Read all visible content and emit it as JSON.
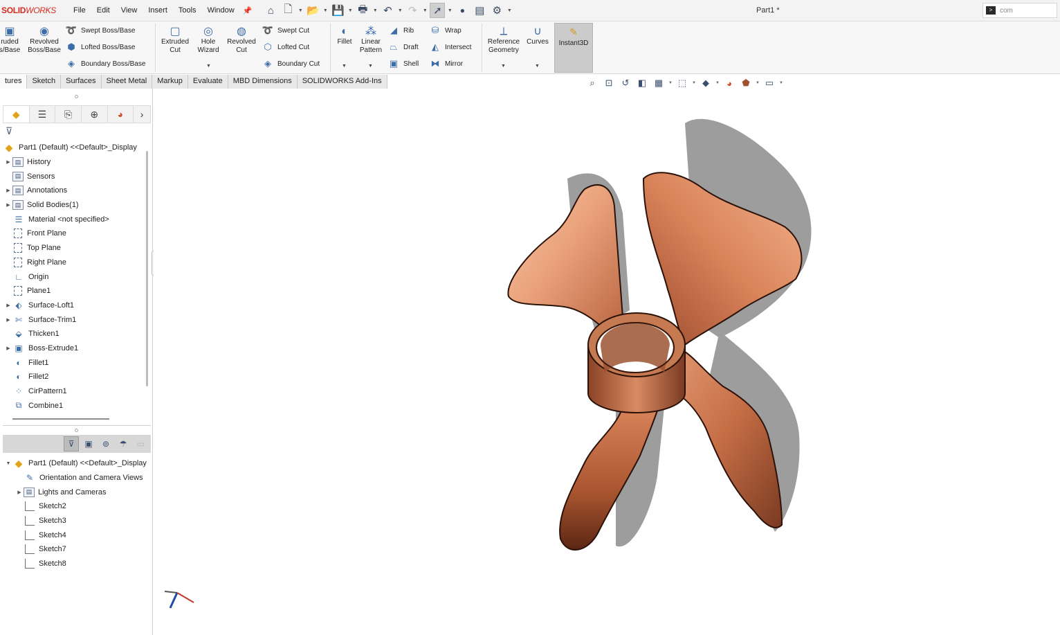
{
  "app": {
    "logo_bold": "SOLID",
    "logo_light": "WORKS",
    "document_title": "Part1 *",
    "search_text": "com"
  },
  "menu": [
    "File",
    "Edit",
    "View",
    "Insert",
    "Tools",
    "Window"
  ],
  "ribbon": {
    "extruded_boss": "ruded\ns/Base",
    "revolved_boss": "Revolved\nBoss/Base",
    "swept_boss": "Swept Boss/Base",
    "lofted_boss": "Lofted Boss/Base",
    "boundary_boss": "Boundary Boss/Base",
    "extruded_cut": "Extruded\nCut",
    "hole_wizard": "Hole\nWizard",
    "revolved_cut": "Revolved\nCut",
    "swept_cut": "Swept Cut",
    "lofted_cut": "Lofted Cut",
    "boundary_cut": "Boundary Cut",
    "fillet": "Fillet",
    "linear_pattern": "Linear\nPattern",
    "rib": "Rib",
    "draft": "Draft",
    "shell": "Shell",
    "wrap": "Wrap",
    "intersect": "Intersect",
    "mirror": "Mirror",
    "reference_geometry": "Reference\nGeometry",
    "curves": "Curves",
    "instant3d": "Instant3D"
  },
  "tabs": [
    {
      "label": "tures",
      "active": true
    },
    {
      "label": "Sketch",
      "active": false
    },
    {
      "label": "Surfaces",
      "active": false
    },
    {
      "label": "Sheet Metal",
      "active": false
    },
    {
      "label": "Markup",
      "active": false
    },
    {
      "label": "Evaluate",
      "active": false
    },
    {
      "label": "MBD Dimensions",
      "active": false
    },
    {
      "label": "SOLIDWORKS Add-Ins",
      "active": false
    }
  ],
  "feature_tree": {
    "root": "Part1 (Default) <<Default>_Display",
    "items": [
      {
        "label": "History",
        "icon": "folder-icon",
        "expandable": true
      },
      {
        "label": "Sensors",
        "icon": "folder-icon",
        "expandable": false
      },
      {
        "label": "Annotations",
        "icon": "folder-icon",
        "expandable": true
      },
      {
        "label": "Solid Bodies(1)",
        "icon": "folder-icon",
        "expandable": true
      },
      {
        "label": "Material <not specified>",
        "icon": "material-icon",
        "expandable": false
      },
      {
        "label": "Front Plane",
        "icon": "plane-icon",
        "expandable": false
      },
      {
        "label": "Top Plane",
        "icon": "plane-icon",
        "expandable": false
      },
      {
        "label": "Right Plane",
        "icon": "plane-icon",
        "expandable": false
      },
      {
        "label": "Origin",
        "icon": "origin-icon",
        "expandable": false
      },
      {
        "label": "Plane1",
        "icon": "plane-icon",
        "expandable": false
      },
      {
        "label": "Surface-Loft1",
        "icon": "surface-loft-icon",
        "expandable": true
      },
      {
        "label": "Surface-Trim1",
        "icon": "surface-trim-icon",
        "expandable": true
      },
      {
        "label": "Thicken1",
        "icon": "thicken-icon",
        "expandable": false
      },
      {
        "label": "Boss-Extrude1",
        "icon": "extrude-icon",
        "expandable": true
      },
      {
        "label": "Fillet1",
        "icon": "fillet-icon",
        "expandable": false
      },
      {
        "label": "Fillet2",
        "icon": "fillet-icon",
        "expandable": false
      },
      {
        "label": "CirPattern1",
        "icon": "circular-pattern-icon",
        "expandable": false
      },
      {
        "label": "Combine1",
        "icon": "combine-icon",
        "expandable": false
      }
    ]
  },
  "display_manager": {
    "root": "Part1 (Default) <<Default>_Display",
    "items": [
      {
        "label": "Orientation and Camera Views",
        "icon": "camera-icon",
        "expandable": false
      },
      {
        "label": "Lights and Cameras",
        "icon": "folder-icon",
        "expandable": true
      },
      {
        "label": "Sketch2",
        "icon": "sketch-icon",
        "expandable": false
      },
      {
        "label": "Sketch3",
        "icon": "sketch-icon",
        "expandable": false
      },
      {
        "label": "Sketch4",
        "icon": "sketch-icon",
        "expandable": false
      },
      {
        "label": "Sketch7",
        "icon": "sketch-icon",
        "expandable": false
      },
      {
        "label": "Sketch8",
        "icon": "sketch-icon",
        "expandable": false
      }
    ]
  },
  "colors": {
    "brand": "#d52b1e",
    "copper_light": "#f3b58f",
    "copper_mid": "#d9865c",
    "copper_dark": "#7a3a22",
    "shadow": "#8c8c8c"
  }
}
